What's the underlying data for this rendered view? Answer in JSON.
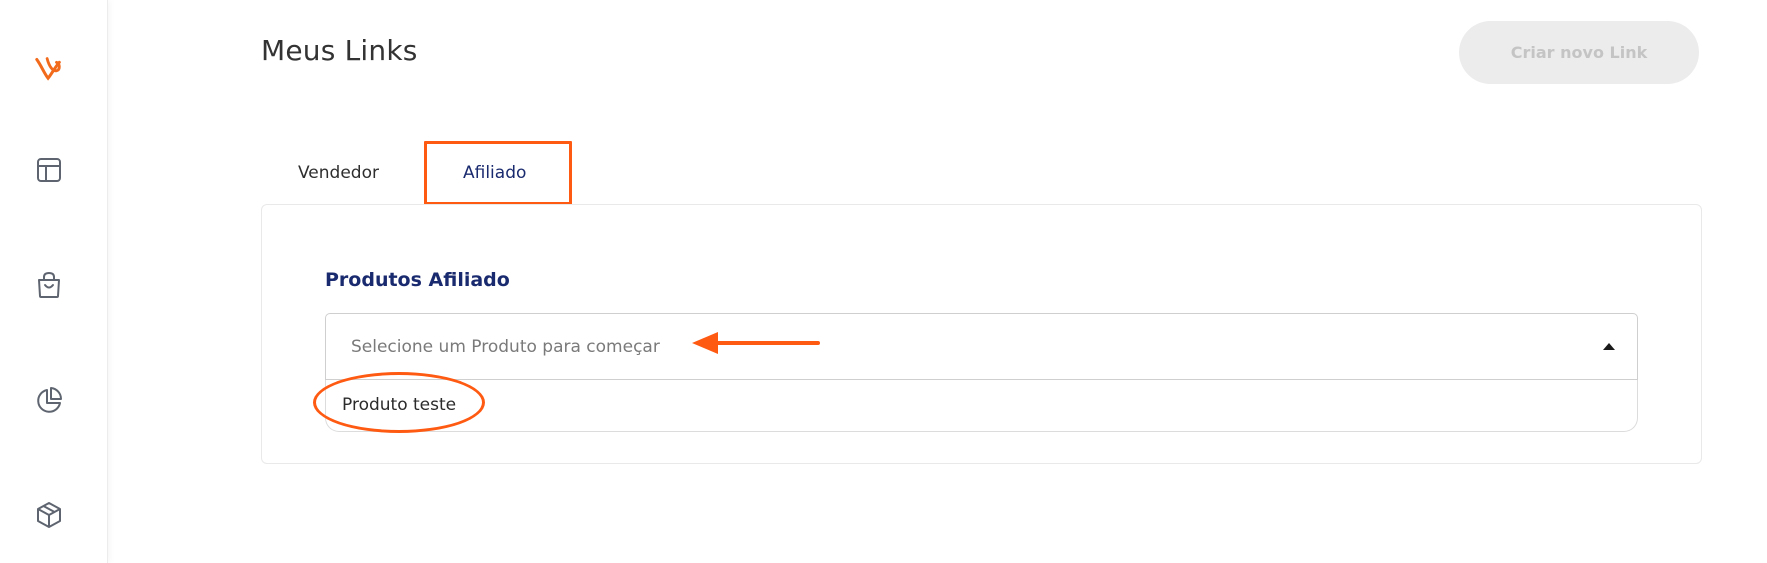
{
  "sidebar": {
    "items": [
      {
        "icon": "logo-icon"
      },
      {
        "icon": "layout-icon"
      },
      {
        "icon": "shopping-bag-icon"
      },
      {
        "icon": "pie-chart-icon"
      },
      {
        "icon": "package-icon"
      }
    ]
  },
  "header": {
    "title": "Meus Links",
    "create_button_label": "Criar novo Link"
  },
  "tabs": [
    {
      "label": "Vendedor",
      "active": false
    },
    {
      "label": "Afiliado",
      "active": true
    }
  ],
  "section": {
    "title": "Produtos Afiliado",
    "select_placeholder": "Selecione um Produto para começar",
    "options": [
      "Produto teste"
    ]
  },
  "colors": {
    "accent": "#ff5a12",
    "brand_navy": "#1a2a6e",
    "button_disabled_bg": "#ececec",
    "button_disabled_text": "#c4c4c4"
  }
}
